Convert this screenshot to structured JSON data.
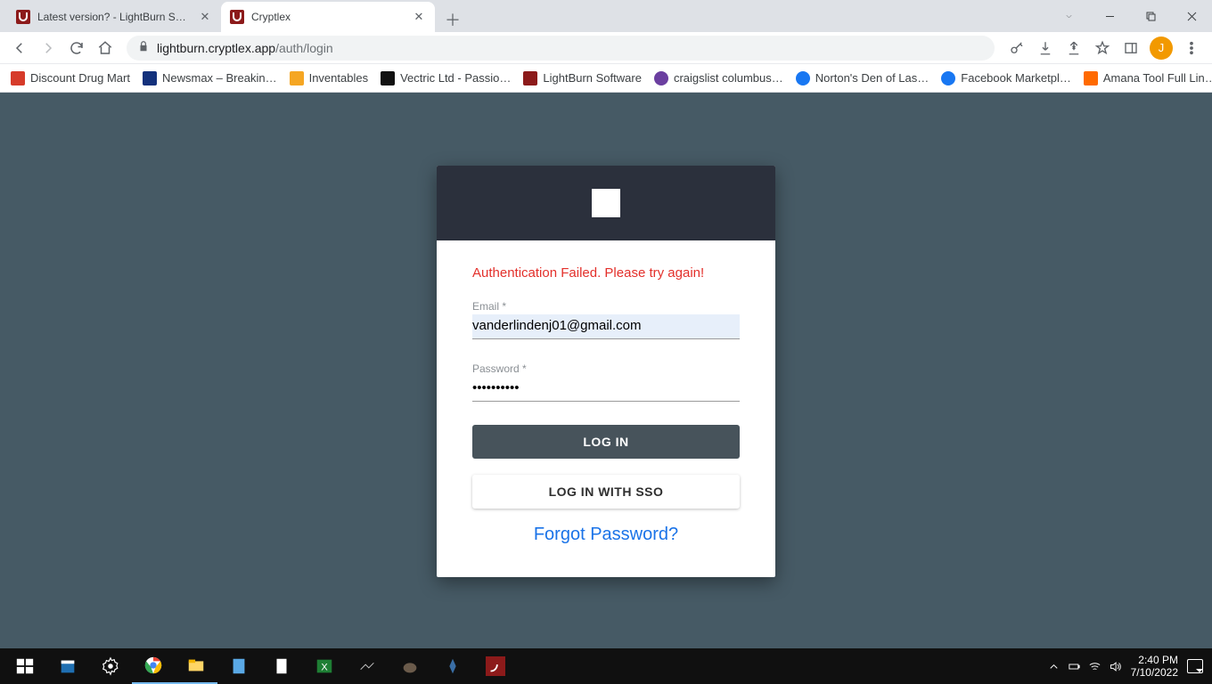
{
  "tabs": [
    {
      "title": "Latest version? - LightBurn Softw",
      "active": false
    },
    {
      "title": "Cryptlex",
      "active": true
    }
  ],
  "url": {
    "host": "lightburn.cryptlex.app",
    "path": "/auth/login"
  },
  "avatar_initial": "J",
  "bookmarks": [
    {
      "label": "Discount Drug Mart",
      "color": "#d63b2a"
    },
    {
      "label": "Newsmax – Breakin…",
      "color": "#13317c"
    },
    {
      "label": "Inventables",
      "color": "#f5a623"
    },
    {
      "label": "Vectric Ltd - Passio…",
      "color": "#111111"
    },
    {
      "label": "LightBurn Software",
      "color": "#8c1a1a"
    },
    {
      "label": "craigslist columbus…",
      "color": "#6b3fa0"
    },
    {
      "label": "Norton's Den of Las…",
      "color": "#1877f2"
    },
    {
      "label": "Facebook Marketpl…",
      "color": "#1877f2"
    },
    {
      "label": "Amana Tool Full Lin…",
      "color": "#ff6a00"
    }
  ],
  "login": {
    "error": "Authentication Failed. Please try again!",
    "email_label": "Email *",
    "email_value": "vanderlindenj01@gmail.com",
    "password_label": "Password *",
    "password_value": "••••••••••",
    "login_btn": "LOG IN",
    "sso_btn": "LOG IN WITH SSO",
    "forgot": "Forgot Password?"
  },
  "clock": {
    "time": "2:40 PM",
    "date": "7/10/2022"
  }
}
